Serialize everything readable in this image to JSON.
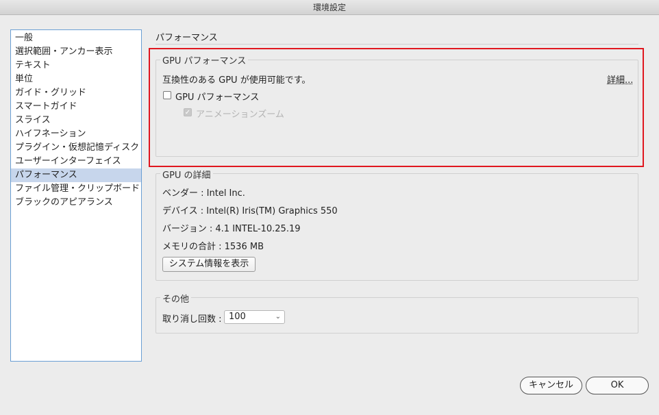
{
  "window": {
    "title": "環境設定"
  },
  "sidebar": {
    "items": [
      {
        "label": "一般"
      },
      {
        "label": "選択範囲・アンカー表示"
      },
      {
        "label": "テキスト"
      },
      {
        "label": "単位"
      },
      {
        "label": "ガイド・グリッド"
      },
      {
        "label": "スマートガイド"
      },
      {
        "label": "スライス"
      },
      {
        "label": "ハイフネーション"
      },
      {
        "label": "プラグイン・仮想記憶ディスク"
      },
      {
        "label": "ユーザーインターフェイス"
      },
      {
        "label": "パフォーマンス",
        "selected": true
      },
      {
        "label": "ファイル管理・クリップボード"
      },
      {
        "label": "ブラックのアピアランス"
      }
    ]
  },
  "main": {
    "section_title": "パフォーマンス",
    "gpu_performance": {
      "group_label": "GPU パフォーマンス",
      "status_text": "互換性のある GPU が使用可能です。",
      "details_link": "詳細...",
      "gpu_checkbox_label": "GPU パフォーマンス",
      "gpu_checkbox_checked": false,
      "animation_zoom_label": "アニメーションズーム",
      "animation_zoom_checked": true
    },
    "gpu_details": {
      "group_label": "GPU の詳細",
      "vendor": "ベンダー : Intel Inc.",
      "device": "デバイス : Intel(R) Iris(TM) Graphics 550",
      "version": "バージョン : 4.1 INTEL-10.25.19",
      "memory": "メモリの合計 : 1536 MB",
      "system_info_button": "システム情報を表示"
    },
    "other": {
      "group_label": "その他",
      "undo_label": "取り消し回数 :",
      "undo_value": "100"
    }
  },
  "footer": {
    "cancel_label": "キャンセル",
    "ok_label": "OK"
  },
  "colors": {
    "highlight": "#e0161e",
    "selection": "#c7d6ec",
    "sidebar_border": "#6a9fd4"
  }
}
